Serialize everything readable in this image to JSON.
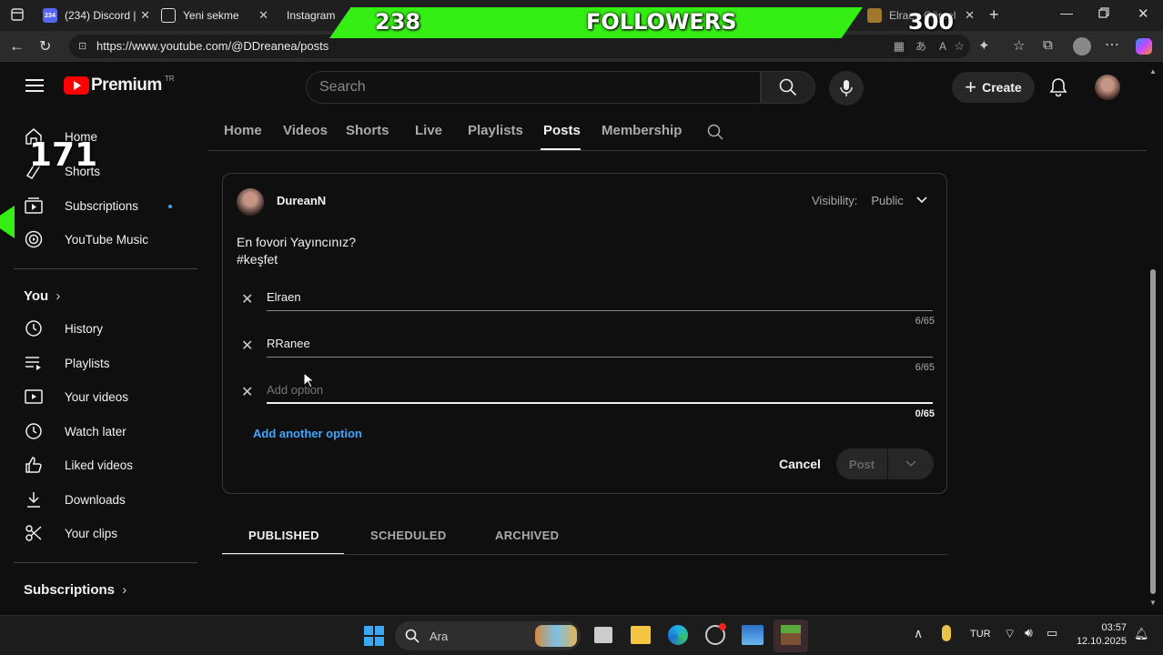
{
  "tabs": [
    {
      "label": "(234) Discord |",
      "badge": "234"
    },
    {
      "label": "Yeni sekme"
    },
    {
      "label": "Instagram"
    },
    {
      "label": "Elraen Görsel"
    }
  ],
  "address": {
    "url": "https://www.youtube.com/@DDreanea/posts"
  },
  "overlay": {
    "followers_count": "238",
    "followers_label": "FOLLOWERS",
    "goal": "300",
    "side_counter": "171"
  },
  "masthead": {
    "brand": "Premium",
    "region": "TR",
    "search_placeholder": "Search",
    "create_label": "Create"
  },
  "sidebar": {
    "top": [
      {
        "label": "Home",
        "icon": "home-icon"
      },
      {
        "label": "Shorts",
        "icon": "shorts-icon"
      },
      {
        "label": "Subscriptions",
        "icon": "subscriptions-icon"
      },
      {
        "label": "YouTube Music",
        "icon": "music-icon"
      }
    ],
    "you_label": "You",
    "you": [
      {
        "label": "History",
        "icon": "history-icon"
      },
      {
        "label": "Playlists",
        "icon": "playlists-icon"
      },
      {
        "label": "Your videos",
        "icon": "your-videos-icon"
      },
      {
        "label": "Watch later",
        "icon": "watch-later-icon"
      },
      {
        "label": "Liked videos",
        "icon": "like-icon"
      },
      {
        "label": "Downloads",
        "icon": "download-icon"
      },
      {
        "label": "Your clips",
        "icon": "clips-icon"
      }
    ],
    "subs_label": "Subscriptions"
  },
  "channel_tabs": [
    "Home",
    "Videos",
    "Shorts",
    "Live",
    "Playlists",
    "Posts",
    "Membership"
  ],
  "active_tab": "Posts",
  "post": {
    "author": "DureanN",
    "visibility_label": "Visibility:",
    "visibility_value": "Public",
    "text_line1": "En fovori Yayıncınız?",
    "text_line2": "#keşfet",
    "options": [
      {
        "value": "Elraen",
        "count": "6/65"
      },
      {
        "value": "RRanee",
        "count": "6/65"
      },
      {
        "value": "",
        "placeholder": "Add option",
        "count": "0/65"
      }
    ],
    "add_option_label": "Add another option",
    "cancel_label": "Cancel",
    "post_label": "Post"
  },
  "post_tabs": [
    "PUBLISHED",
    "SCHEDULED",
    "ARCHIVED"
  ],
  "taskbar": {
    "search_label": "Ara",
    "lang": "TUR",
    "time": "03:57",
    "date": "12.10.2025"
  },
  "colors": {
    "accent_green": "#35ee14",
    "yt_red": "#ff0000",
    "link_blue": "#3ea6ff"
  }
}
